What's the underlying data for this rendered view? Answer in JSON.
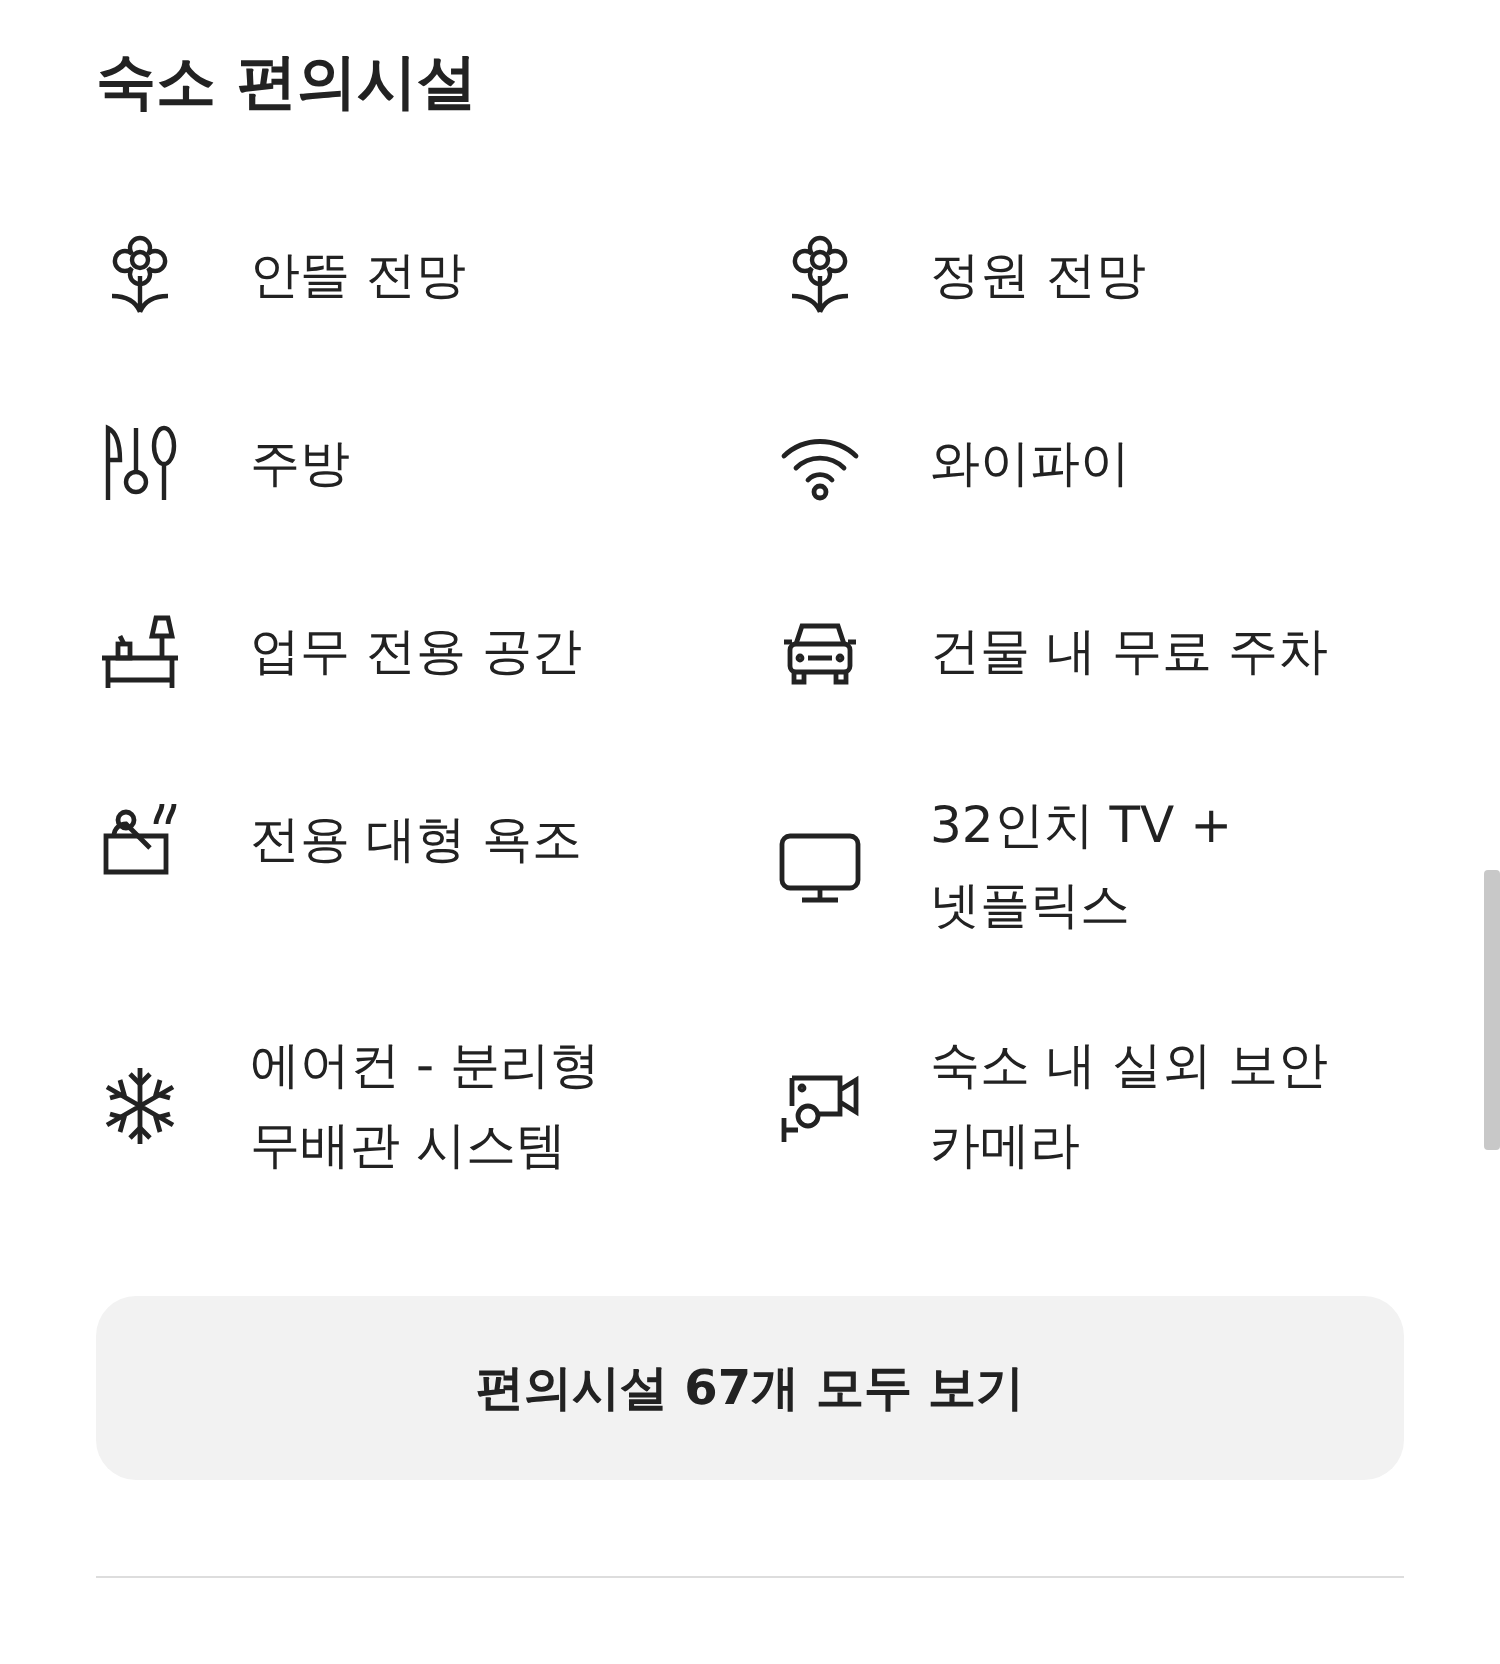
{
  "title": "숙소 편의시설",
  "amenities": [
    {
      "label": "안뜰 전망"
    },
    {
      "label": "정원 전망"
    },
    {
      "label": "주방"
    },
    {
      "label": "와이파이"
    },
    {
      "label": "업무 전용 공간"
    },
    {
      "label": "건물 내 무료 주차"
    },
    {
      "label": "전용 대형 욕조"
    },
    {
      "label": "32인치 TV + 넷플릭스"
    },
    {
      "label": "에어컨 - 분리형 무배관 시스템"
    },
    {
      "label": "숙소 내 실외 보안 카메라"
    }
  ],
  "show_all_button": "편의시설 67개 모두 보기"
}
